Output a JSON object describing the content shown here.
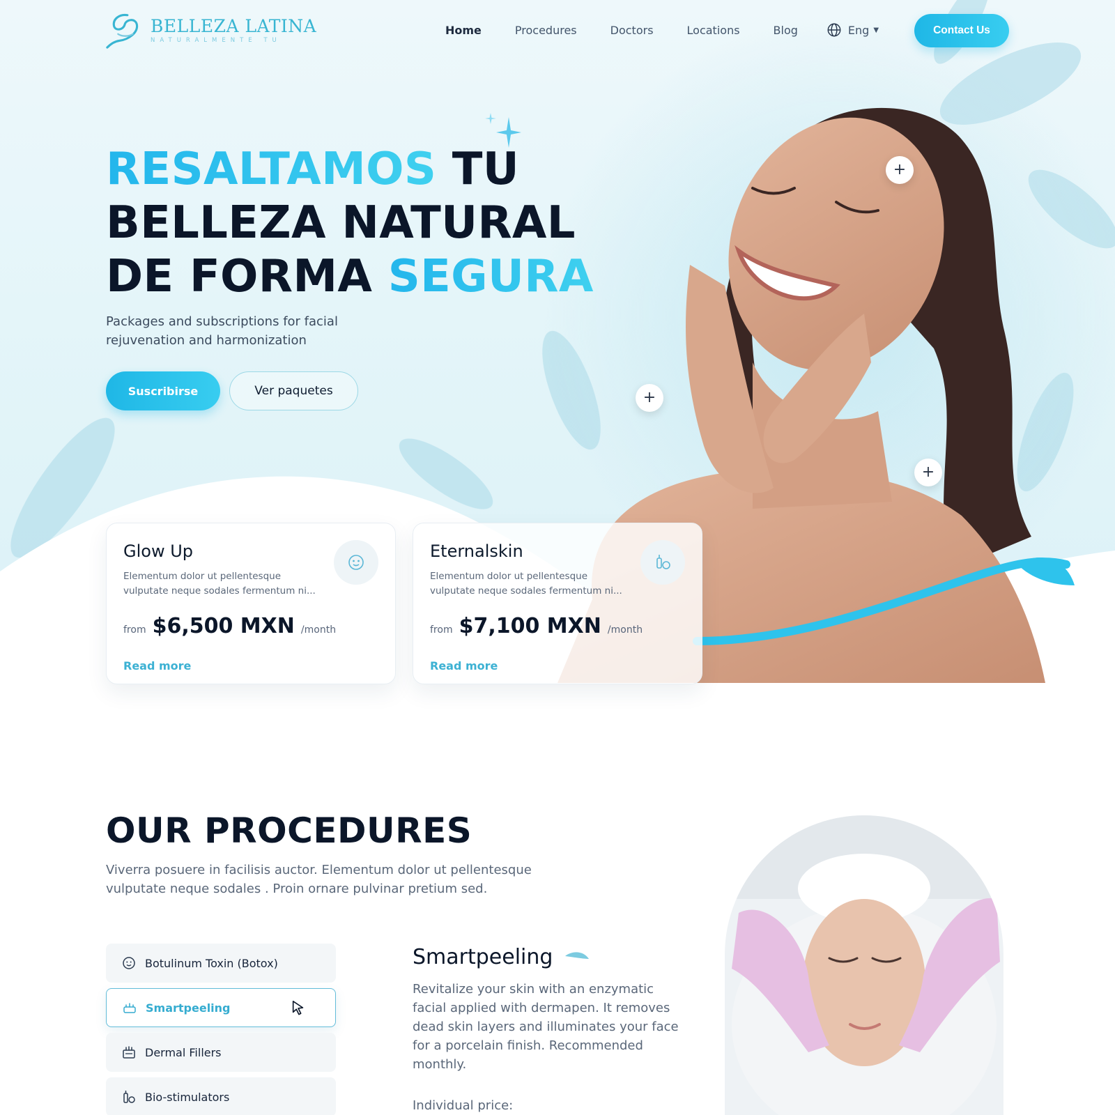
{
  "brand": {
    "name": "BELLEZA LATINA",
    "tagline": "NATURALMENTE TU",
    "accent": "#27C0EE",
    "dark": "#0B1629"
  },
  "nav": {
    "items": [
      {
        "label": "Home",
        "active": true
      },
      {
        "label": "Procedures"
      },
      {
        "label": "Doctors"
      },
      {
        "label": "Locations"
      },
      {
        "label": "Blog"
      }
    ],
    "language": "Eng",
    "contact_label": "Contact Us"
  },
  "hero": {
    "title_line1_highlight": "RESALTAMOS",
    "title_line1_rest": " TU",
    "title_line2": "BELLEZA NATURAL",
    "title_line3_start": "DE FORMA ",
    "title_line3_highlight": "SEGURA",
    "subtitle": "Packages and subscriptions for facial rejuvenation and harmonization",
    "primary_button": "Suscribirse",
    "secondary_button": "Ver paquetes"
  },
  "packages": [
    {
      "title": "Glow Up",
      "description": "Elementum dolor ut pellentesque vulputate neque sodales fermentum ni...",
      "from": "from",
      "price": "$6,500 MXN",
      "per": "/month",
      "link": "Read more",
      "icon": "face-mask-icon"
    },
    {
      "title": "Eternalskin",
      "description": "Elementum dolor ut pellentesque vulputate neque sodales fermentum ni...",
      "from": "from",
      "price": "$7,100 MXN",
      "per": "/month",
      "link": "Read more",
      "icon": "serum-bottle-icon"
    }
  ],
  "procedures": {
    "title": "OUR PROCEDURES",
    "subtitle": "Viverra posuere in facilisis auctor. Elementum dolor ut pellentesque vulputate neque sodales . Proin ornare pulvinar pretium sed.",
    "items": [
      {
        "label": "Botulinum Toxin (Botox)",
        "icon": "face-icon"
      },
      {
        "label": "Smartpeeling",
        "icon": "peeling-icon",
        "active": true
      },
      {
        "label": "Dermal Fillers",
        "icon": "filler-icon"
      },
      {
        "label": "Bio-stimulators",
        "icon": "bottle-icon"
      }
    ],
    "detail": {
      "title": "Smartpeeling",
      "text": "Revitalize your skin with an enzymatic facial applied with dermapen. It removes dead skin layers and illuminates your face for a porcelain finish. Recommended monthly.",
      "price_label": "Individual price:"
    }
  }
}
